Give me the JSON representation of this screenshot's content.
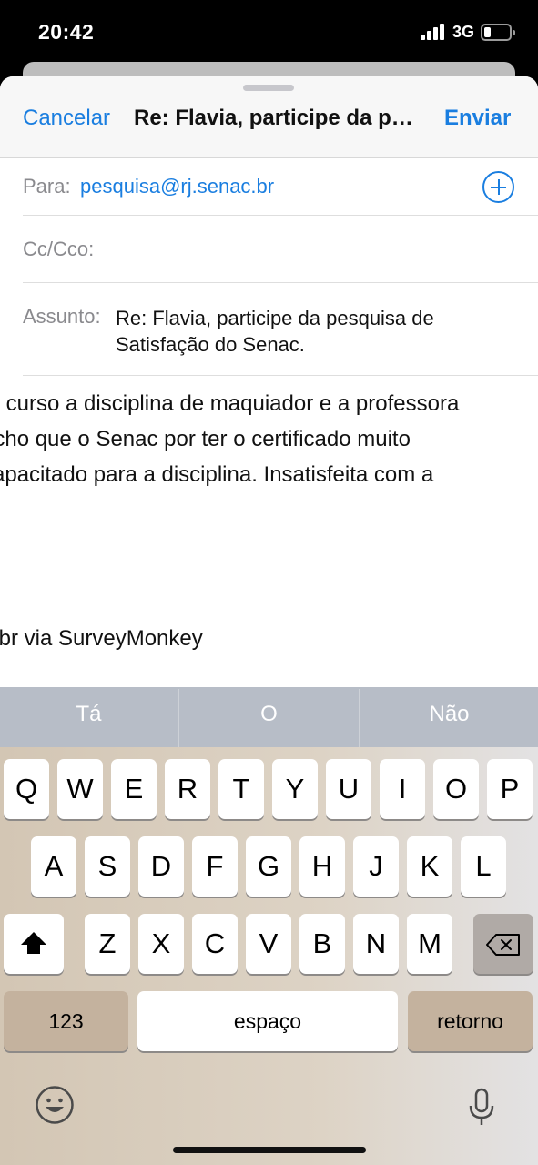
{
  "status": {
    "time": "20:42",
    "network": "3G"
  },
  "compose": {
    "cancel_label": "Cancelar",
    "title": "Re: Flavia, participe da p…",
    "send_label": "Enviar",
    "to_label": "Para:",
    "to_value": "pesquisa@rj.senac.br",
    "cc_label": "Cc/Cco:",
    "subject_label": "Assunto:",
    "subject_value": "Re: Flavia, participe da pesquisa de Satisfação do Senac.",
    "body_lines": [
      "o, curso a disciplina de maquiador e a professora",
      "acho que o Senac por ter o certificado muito",
      "capacitado para a disciplina. Insatisfeita com a"
    ],
    "body_footer": "c.br via SurveyMonkey"
  },
  "keyboard": {
    "suggestions": [
      "Tá",
      "O",
      "Não"
    ],
    "row1": [
      "Q",
      "W",
      "E",
      "R",
      "T",
      "Y",
      "U",
      "I",
      "O",
      "P"
    ],
    "row2": [
      "A",
      "S",
      "D",
      "F",
      "G",
      "H",
      "J",
      "K",
      "L"
    ],
    "row3": [
      "Z",
      "X",
      "C",
      "V",
      "B",
      "N",
      "M"
    ],
    "numbers_label": "123",
    "space_label": "espaço",
    "return_label": "retorno"
  },
  "icons": {
    "shift": "shift-icon",
    "backspace": "backspace-icon",
    "emoji": "emoji-icon",
    "mic": "microphone-icon",
    "add_recipient": "plus-circle-icon"
  },
  "colors": {
    "accent": "#1a7ee0",
    "keyboard_bg": "#d3c6b4",
    "suggestion_bar": "#b7bdc7"
  }
}
